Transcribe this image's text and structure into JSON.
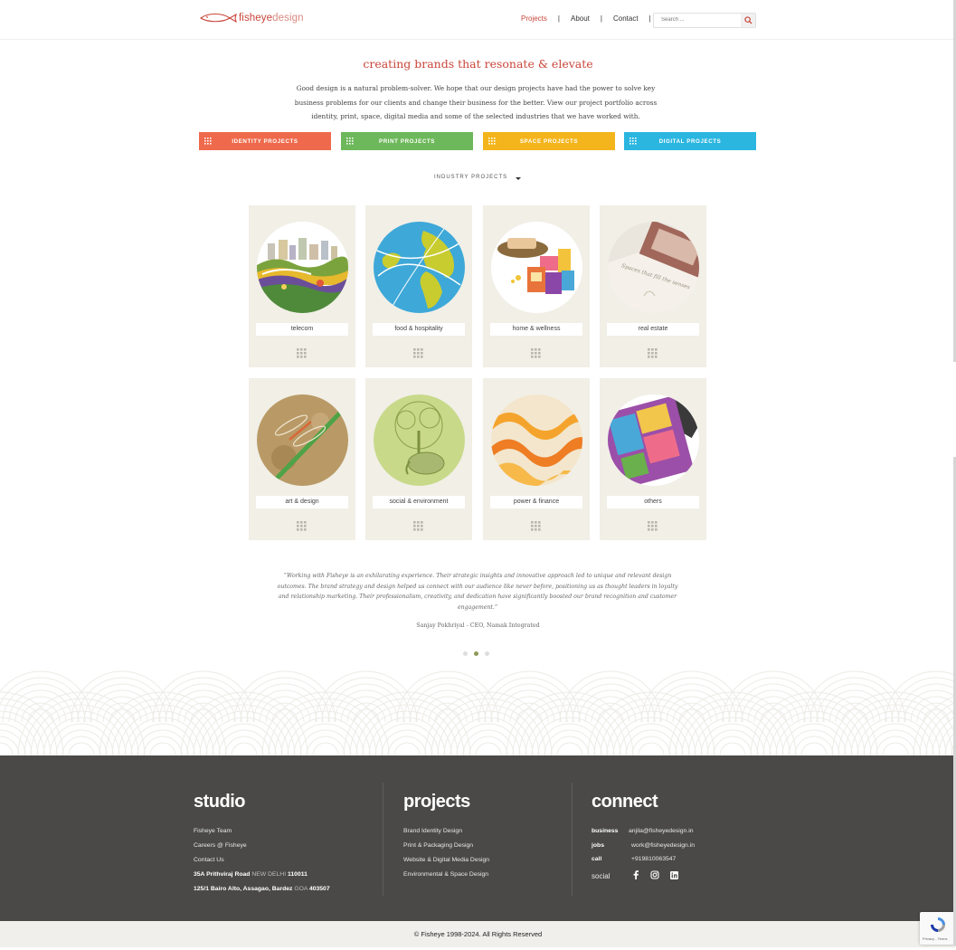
{
  "header": {
    "logo_text_strong": "fisheye",
    "logo_text_light": "design",
    "nav": [
      "Projects",
      "About",
      "Contact"
    ],
    "search_placeholder": "Search ..."
  },
  "intro": {
    "headline": "creating brands that resonate & elevate",
    "body": "Good design is a natural problem-solver. We hope that our design projects have had the power to solve key business problems for our clients and change their business for the better. View our project portfolio across identity, print, space, digital media and some of the selected industries that we have worked with."
  },
  "categories": [
    {
      "label": "IDENTITY PROJECTS",
      "color": "#ef6a4c"
    },
    {
      "label": "PRINT PROJECTS",
      "color": "#6db85a"
    },
    {
      "label": "SPACE PROJECTS",
      "color": "#f3b51b"
    },
    {
      "label": "DIGITAL PROJECTS",
      "color": "#2bb6e0"
    }
  ],
  "industry_dropdown": "INDUSTRY PROJECTS",
  "industries": [
    {
      "label": "telecom",
      "icon": "city-landscape-illustration"
    },
    {
      "label": "food & hospitality",
      "icon": "globe-illustration"
    },
    {
      "label": "home & wellness",
      "icon": "soap-packaging-photo"
    },
    {
      "label": "real estate",
      "icon": "brochure-photo"
    },
    {
      "label": "art & design",
      "icon": "dragonfly-illustration"
    },
    {
      "label": "social & environment",
      "icon": "tree-elephant-illustration"
    },
    {
      "label": "power & finance",
      "icon": "orange-waves-illustration"
    },
    {
      "label": "others",
      "icon": "magazine-photo"
    }
  ],
  "testimonial": {
    "quote": "“Working with Fisheye is an exhilarating experience. Their strategic insights and innovative approach led to unique and relevant design outcomes. The brand strategy and design helped us connect with our audience like never before, positioning us as thought leaders in loyalty and relationship marketing. Their professionalism, creativity, and dedication have significantly boosted our brand recognition and customer engagement.”",
    "author": "Sanjay Pokhriyal - CEO, Namak Integrated",
    "active_slide": 2,
    "slide_count": 3
  },
  "footer": {
    "studio": {
      "title": "studio",
      "links": [
        "Fisheye Team",
        "Careers @ Fisheye",
        "Contact Us"
      ],
      "addr1_street": "35A Prithviraj Road",
      "addr1_city": "NEW DELHI",
      "addr1_pin": "110011",
      "addr2_street": "125/1 Bairo Alto, Assagao, Bardez",
      "addr2_city": "GOA",
      "addr2_pin": "403507"
    },
    "projects": {
      "title": "projects",
      "links": [
        "Brand Identity Design",
        "Print & Packaging Design",
        "Website & Digital Media Design",
        "Environmental & Space Design"
      ]
    },
    "connect": {
      "title": "connect",
      "rows": [
        {
          "key": "business",
          "value": "anjila@fisheyedesign.in"
        },
        {
          "key": "jobs",
          "value": "work@fisheyedesign.in"
        },
        {
          "key": "call",
          "value": "+919810063547"
        }
      ],
      "social_label": "social",
      "social_icons": [
        "facebook-icon",
        "instagram-icon",
        "linkedin-icon"
      ]
    },
    "copyright": "© Fisheye 1998-2024. All Rights Reserved"
  },
  "recaptcha_text": "Privacy - Terms"
}
